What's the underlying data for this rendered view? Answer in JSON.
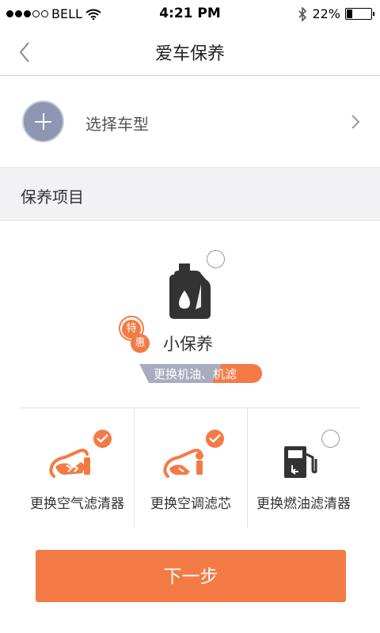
{
  "status_bar": {
    "carrier": "BELL",
    "time": "4:21 PM",
    "battery_percent": "22%",
    "battery_level": 0.22,
    "icons": [
      "signal-dots-icon",
      "wifi-icon",
      "bluetooth-icon",
      "battery-icon"
    ]
  },
  "nav": {
    "title": "爱车保养",
    "back_icon": "chevron-left-icon"
  },
  "car_select": {
    "label": "选择车型",
    "icon": "plus-circle-icon",
    "chevron_icon": "chevron-right-icon"
  },
  "section": {
    "title": "保养项目"
  },
  "main_package": {
    "name": "小保养",
    "badge_top": "特",
    "badge_bottom": "惠",
    "tag_text_gray": "更换机油、",
    "tag_text_orange": "机滤",
    "selected": false,
    "icon": "oil-bottle-icon"
  },
  "items": [
    {
      "label": "更换空气滤清器",
      "checked": true,
      "icon": "air-filter-icon"
    },
    {
      "label": "更换空调滤芯",
      "checked": true,
      "icon": "ac-filter-icon"
    },
    {
      "label": "更换燃油滤清器",
      "checked": false,
      "icon": "fuel-pump-icon"
    }
  ],
  "next_button": {
    "label": "下一步"
  },
  "colors": {
    "accent": "#f47a45",
    "tag_gray": "#a9acbf",
    "plus_circle": "#8e96b3",
    "section_bg": "#f2f2f4"
  }
}
